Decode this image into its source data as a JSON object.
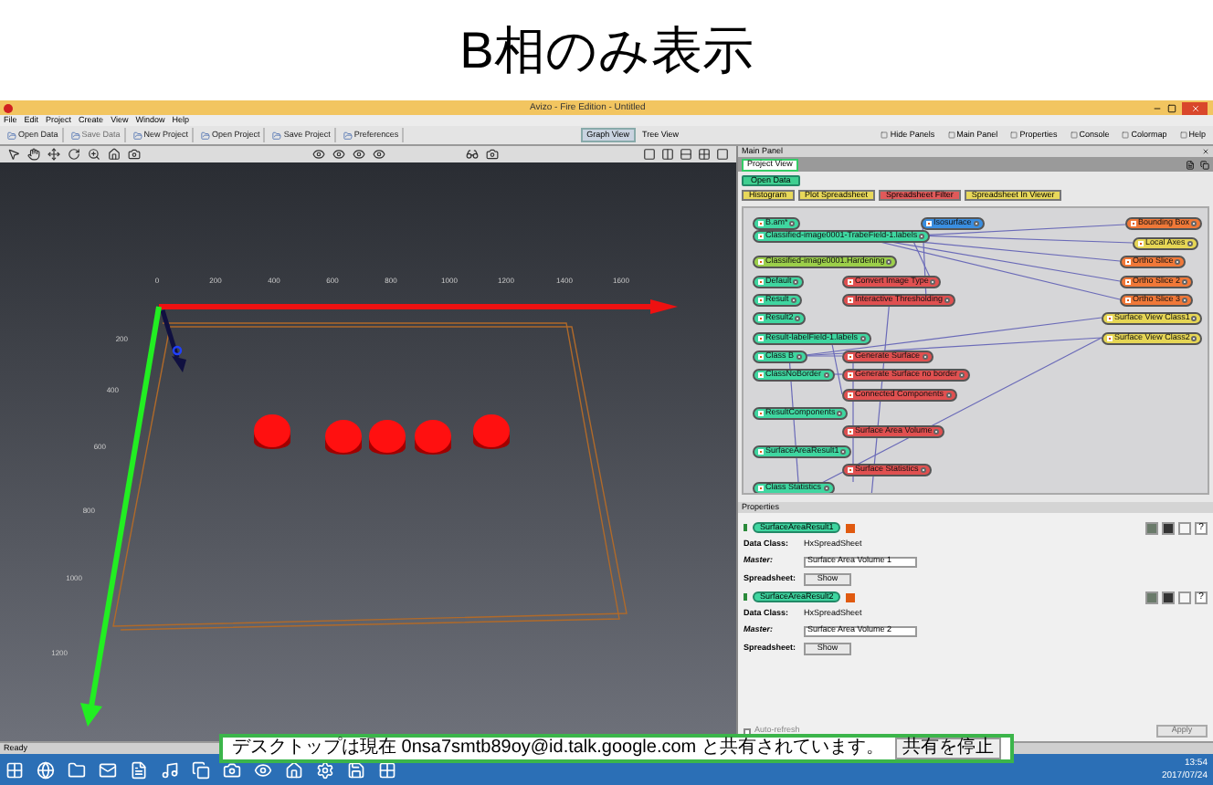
{
  "slide_title": "B相のみ表示",
  "window": {
    "title": "Avizo - Fire Edition - Untitled"
  },
  "menu": [
    "File",
    "Edit",
    "Project",
    "Create",
    "View",
    "Window",
    "Help"
  ],
  "toolbar": [
    {
      "label": "Open Data",
      "disabled": false
    },
    {
      "label": "Save Data",
      "disabled": true
    },
    {
      "label": "New Project",
      "disabled": false
    },
    {
      "label": "Open Project",
      "disabled": false
    },
    {
      "label": "Save Project",
      "disabled": false
    },
    {
      "label": "Preferences",
      "disabled": false
    }
  ],
  "view_buttons": [
    {
      "label": "Graph View",
      "selected": true
    },
    {
      "label": "Tree View",
      "selected": false
    }
  ],
  "panel_buttons": [
    "Hide Panels",
    "Main Panel",
    "Properties",
    "Console",
    "Colormap",
    "Help"
  ],
  "viewer": {
    "x_ticks": [
      "0",
      "200",
      "400",
      "600",
      "800",
      "1000",
      "1200",
      "1400",
      "1600"
    ],
    "y_ticks": [
      "200",
      "400",
      "600",
      "800",
      "1000",
      "1200"
    ]
  },
  "main_panel": {
    "title": "Main Panel",
    "tabs": [
      {
        "label": "Project View",
        "selected": true
      }
    ],
    "open_data": "Open Data",
    "modules": [
      {
        "label": "Histogram",
        "color": "#e8d85a"
      },
      {
        "label": "Plot Spreadsheet",
        "color": "#e8d85a"
      },
      {
        "label": "Spreadsheet Filter",
        "color": "#e05a5a"
      },
      {
        "label": "Spreadsheet In Viewer",
        "color": "#e8d85a"
      }
    ],
    "nodes": [
      {
        "label": "B.am*",
        "kind": "data"
      },
      {
        "label": "Isosurface",
        "kind": "viewer"
      },
      {
        "label": "Classified-image0001-TrabeField-1.labels",
        "kind": "data"
      },
      {
        "label": "Classified-image0001.Hardening",
        "kind": "image"
      },
      {
        "label": "Default",
        "kind": "data"
      },
      {
        "label": "Result",
        "kind": "data"
      },
      {
        "label": "Result2",
        "kind": "data"
      },
      {
        "label": "Result-labelField-1.labels",
        "kind": "data"
      },
      {
        "label": "Class B",
        "kind": "data"
      },
      {
        "label": "ClassNoBorder",
        "kind": "data"
      },
      {
        "label": "ResultComponents",
        "kind": "data"
      },
      {
        "label": "SurfaceAreaResult1",
        "kind": "data"
      },
      {
        "label": "Class Statistics",
        "kind": "data"
      },
      {
        "label": "Convert Image Type",
        "kind": "compute"
      },
      {
        "label": "Interactive Thresholding",
        "kind": "compute"
      },
      {
        "label": "Generate Surface",
        "kind": "compute"
      },
      {
        "label": "Generate Surface no border",
        "kind": "compute"
      },
      {
        "label": "Connected Components",
        "kind": "compute"
      },
      {
        "label": "Surface Area Volume",
        "kind": "compute"
      },
      {
        "label": "Surface Statistics",
        "kind": "compute"
      },
      {
        "label": "Bounding Box",
        "kind": "display"
      },
      {
        "label": "Local Axes",
        "kind": "view"
      },
      {
        "label": "Ortho Slice",
        "kind": "display"
      },
      {
        "label": "Ortho Slice 2",
        "kind": "display"
      },
      {
        "label": "Ortho Slice 3",
        "kind": "display"
      },
      {
        "label": "Surface View Class1",
        "kind": "view"
      },
      {
        "label": "Surface View Class2",
        "kind": "view"
      }
    ]
  },
  "properties": {
    "title": "Properties",
    "items": [
      {
        "node": "SurfaceAreaResult1",
        "data_class_label": "Data Class:",
        "data_class": "HxSpreadSheet",
        "master_label": "Master:",
        "master": "Surface Area Volume 1",
        "spreadsheet_label": "Spreadsheet:",
        "spreadsheet_button": "Show",
        "help": "?"
      },
      {
        "node": "SurfaceAreaResult2",
        "data_class_label": "Data Class:",
        "data_class": "HxSpreadSheet",
        "master_label": "Master:",
        "master": "Surface Area Volume 2",
        "spreadsheet_label": "Spreadsheet:",
        "spreadsheet_button": "Show",
        "help": "?"
      }
    ],
    "auto_refresh": {
      "label": "Auto-refresh",
      "checked": false
    },
    "apply": {
      "label": "Apply",
      "disabled": true
    }
  },
  "status_bar": "Ready",
  "notification": {
    "text": "デスクトップは現在 0nsa7smtb89oy@id.talk.google.com と共有されています。",
    "button": "共有を停止"
  },
  "taskbar": {
    "time": "13:54",
    "date": "2017/07/24"
  }
}
